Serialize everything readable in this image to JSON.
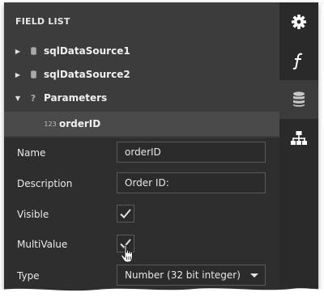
{
  "panel": {
    "title": "FIELD LIST"
  },
  "tree": {
    "items": [
      {
        "label": "sqlDataSource1",
        "icon": "database-icon",
        "expanded": false
      },
      {
        "label": "sqlDataSource2",
        "icon": "database-icon",
        "expanded": false
      },
      {
        "label": "Parameters",
        "icon": "question-icon",
        "expanded": true
      },
      {
        "label": "orderID",
        "icon": "number-type-icon",
        "type_glyph": "123",
        "selected": true
      }
    ]
  },
  "properties": {
    "name": {
      "label": "Name",
      "value": "orderID"
    },
    "description": {
      "label": "Description",
      "value": "Order ID:"
    },
    "visible": {
      "label": "Visible",
      "checked": true
    },
    "multivalue": {
      "label": "MultiValue",
      "checked": true
    },
    "type": {
      "label": "Type",
      "value": "Number (32 bit integer)"
    }
  },
  "rail": {
    "buttons": [
      {
        "icon": "gear-icon",
        "active": false
      },
      {
        "icon": "function-icon",
        "active": false
      },
      {
        "icon": "database-icon",
        "active": true
      },
      {
        "icon": "hierarchy-icon",
        "active": false
      }
    ]
  },
  "colors": {
    "panel_bg": "#2e2e2e",
    "tree_bg": "#3c3c3c",
    "rail_bg": "#2a2a2a",
    "rail_active_bg": "#3c3c3c",
    "text": "#eaeaea",
    "border": "#5a5a5a"
  }
}
